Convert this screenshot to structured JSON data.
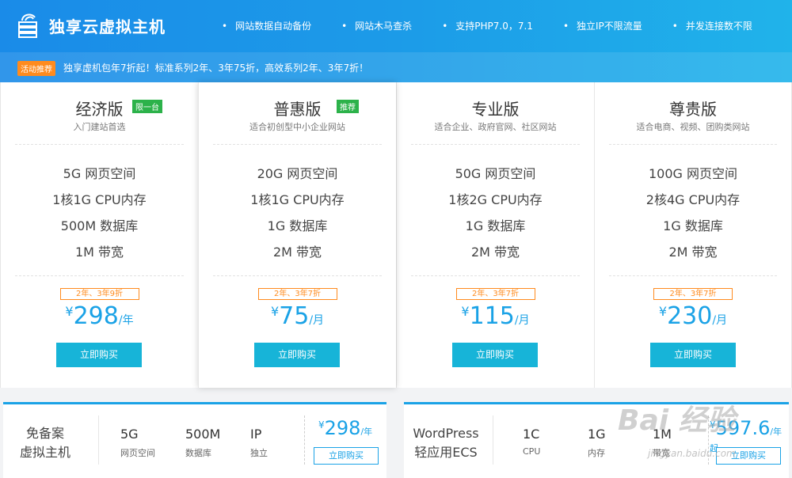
{
  "header": {
    "title": "独享云虚拟主机",
    "features": [
      "网站数据自动备份",
      "网站木马查杀",
      "支持PHP7.0，7.1",
      "独立IP不限流量",
      "并发连接数不限"
    ],
    "promo_tag": "活动推荐",
    "promo_text": "独享虚机包年7折起！标准系列2年、3年75折，高效系列2年、3年7折！"
  },
  "plans": [
    {
      "name": "经济版",
      "badge": "限一台",
      "subtitle": "入门建站首选",
      "specs": [
        "5G 网页空间",
        "1核1G CPU内存",
        "500M 数据库",
        "1M 带宽"
      ],
      "discount": "2年、3年9折",
      "currency": "¥",
      "price": "298",
      "unit": "/年",
      "button": "立即购买"
    },
    {
      "name": "普惠版",
      "badge": "推荐",
      "subtitle": "适合初创型中小企业网站",
      "specs": [
        "20G 网页空间",
        "1核1G CPU内存",
        "1G 数据库",
        "2M 带宽"
      ],
      "discount": "2年、3年7折",
      "currency": "¥",
      "price": "75",
      "unit": "/月",
      "button": "立即购买"
    },
    {
      "name": "专业版",
      "badge": "",
      "subtitle": "适合企业、政府官网、社区网站",
      "specs": [
        "50G 网页空间",
        "1核2G CPU内存",
        "1G 数据库",
        "2M 带宽"
      ],
      "discount": "2年、3年7折",
      "currency": "¥",
      "price": "115",
      "unit": "/月",
      "button": "立即购买"
    },
    {
      "name": "尊贵版",
      "badge": "",
      "subtitle": "适合电商、视频、团购类网站",
      "specs": [
        "100G 网页空间",
        "2核4G CPU内存",
        "1G 数据库",
        "2M 带宽"
      ],
      "discount": "2年、3年7折",
      "currency": "¥",
      "price": "230",
      "unit": "/月",
      "button": "立即购买"
    }
  ],
  "bottom_cards": [
    {
      "title_line1": "免备案",
      "title_line2": "虚拟主机",
      "specs": [
        {
          "value": "5G",
          "label": "网页空间"
        },
        {
          "value": "500M",
          "label": "数据库"
        },
        {
          "value": "IP",
          "label": "独立"
        }
      ],
      "currency": "¥",
      "price": "298",
      "unit": "/年",
      "button": "立即购买"
    },
    {
      "title_line1": "WordPress",
      "title_line2": "轻应用ECS",
      "specs": [
        {
          "value": "1C",
          "label": "CPU"
        },
        {
          "value": "1G",
          "label": "内存"
        },
        {
          "value": "1M",
          "label": "带宽"
        }
      ],
      "currency": "¥",
      "price": "597.6",
      "unit": "/年起",
      "button": "立即购买"
    }
  ],
  "watermark": {
    "text": "Bai 经验",
    "url": "jingyan.baidu.com"
  },
  "colors": {
    "header_start": "#1a8be8",
    "header_end": "#20b3ea",
    "accent": "#1aa2e6",
    "button": "#17b4d8",
    "promo_tag": "#ff8b1e",
    "badge_green": "#2cb24a"
  }
}
